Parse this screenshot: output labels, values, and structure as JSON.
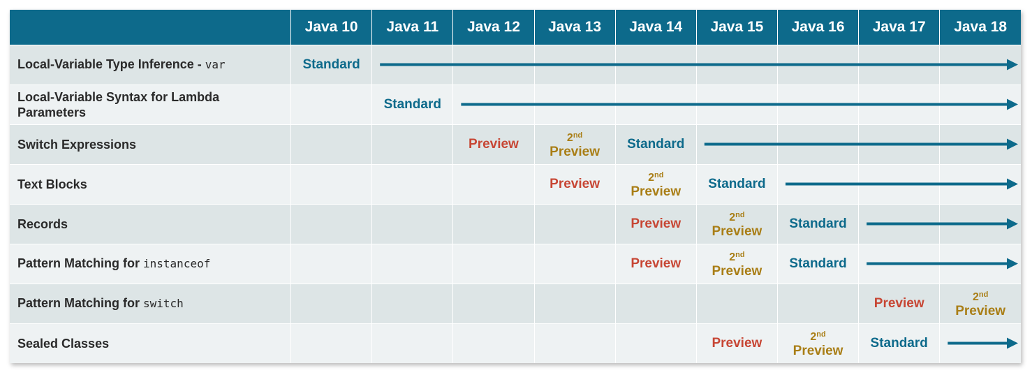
{
  "chart_data": {
    "type": "table",
    "header": {
      "corner": "",
      "versions": [
        "Java 10",
        "Java 11",
        "Java 12",
        "Java 13",
        "Java 14",
        "Java 15",
        "Java 16",
        "Java 17",
        "Java 18"
      ]
    },
    "status_labels": {
      "standard": "Standard",
      "preview": "Preview",
      "second_ordinal": "2",
      "second_suffix": "nd",
      "second_word": "Preview"
    },
    "rows": [
      {
        "feature": "Local-Variable Type Inference - ",
        "code": "var",
        "cells": [
          "standard",
          "",
          "",
          "",
          "",
          "",
          "",
          "",
          ""
        ],
        "arrow": true
      },
      {
        "feature": "Local-Variable Syntax for Lambda Parameters",
        "code": "",
        "cells": [
          "",
          "standard",
          "",
          "",
          "",
          "",
          "",
          "",
          ""
        ],
        "arrow": true
      },
      {
        "feature": "Switch Expressions",
        "code": "",
        "cells": [
          "",
          "",
          "preview",
          "second",
          "standard",
          "",
          "",
          "",
          ""
        ],
        "arrow": true
      },
      {
        "feature": "Text Blocks",
        "code": "",
        "cells": [
          "",
          "",
          "",
          "preview",
          "second",
          "standard",
          "",
          "",
          ""
        ],
        "arrow": true
      },
      {
        "feature": "Records",
        "code": "",
        "cells": [
          "",
          "",
          "",
          "",
          "preview",
          "second",
          "standard",
          "",
          ""
        ],
        "arrow": true
      },
      {
        "feature": "Pattern Matching for ",
        "code": "instanceof",
        "cells": [
          "",
          "",
          "",
          "",
          "preview",
          "second",
          "standard",
          "",
          ""
        ],
        "arrow": true
      },
      {
        "feature": "Pattern Matching for ",
        "code": "switch",
        "cells": [
          "",
          "",
          "",
          "",
          "",
          "",
          "",
          "preview",
          "second"
        ],
        "arrow": false
      },
      {
        "feature": "Sealed Classes",
        "code": "",
        "cells": [
          "",
          "",
          "",
          "",
          "",
          "preview",
          "second",
          "standard",
          ""
        ],
        "arrow": true
      }
    ],
    "colors": {
      "header_bg": "#0d6a8b",
      "standard": "#0d6a8b",
      "preview": "#c74634",
      "second_preview": "#a97e16",
      "row_dark": "#dde5e6",
      "row_light": "#eef2f3"
    }
  }
}
